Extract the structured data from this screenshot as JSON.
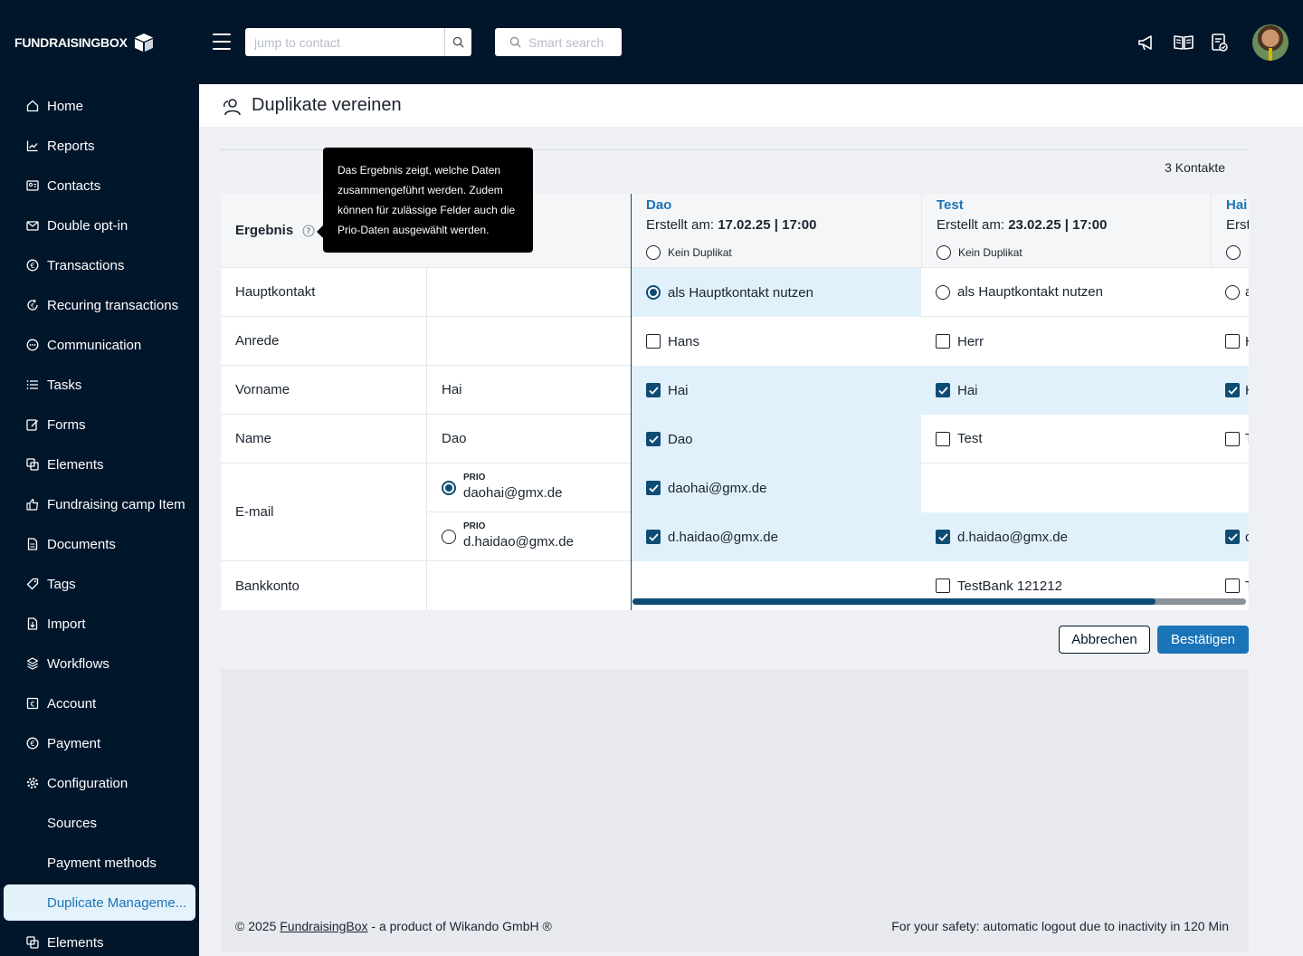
{
  "brand": {
    "name": "FUNDRAISINGBOX"
  },
  "topbar": {
    "jump_placeholder": "jump to contact",
    "smart_search_placeholder": "Smart search",
    "icons": [
      "megaphone-icon",
      "book-icon",
      "checklist-icon"
    ]
  },
  "sidebar": {
    "items": [
      {
        "label": "Home",
        "icon": "home-icon"
      },
      {
        "label": "Reports",
        "icon": "chart-icon"
      },
      {
        "label": "Contacts",
        "icon": "contacts-icon"
      },
      {
        "label": "Double opt-in",
        "icon": "mail-icon"
      },
      {
        "label": "Transactions",
        "icon": "euro-icon"
      },
      {
        "label": "Recuring transactions",
        "icon": "recurring-icon"
      },
      {
        "label": "Communication",
        "icon": "chat-icon"
      },
      {
        "label": "Tasks",
        "icon": "list-icon"
      },
      {
        "label": "Forms",
        "icon": "form-icon"
      },
      {
        "label": "Elements",
        "icon": "elements-icon"
      },
      {
        "label": "Fundraising camp Item",
        "icon": "thumbs-up-icon"
      },
      {
        "label": "Documents",
        "icon": "document-icon"
      },
      {
        "label": "Tags",
        "icon": "tag-icon"
      },
      {
        "label": "Import",
        "icon": "import-icon"
      },
      {
        "label": "Workflows",
        "icon": "workflow-icon"
      },
      {
        "label": "Account",
        "icon": "account-icon"
      },
      {
        "label": "Payment",
        "icon": "euro-icon"
      },
      {
        "label": "Configuration",
        "icon": "gear-icon"
      },
      {
        "label": "Sources",
        "icon": ""
      },
      {
        "label": "Payment methods",
        "icon": ""
      },
      {
        "label": "Duplicate Manageme...",
        "icon": "",
        "active": true
      },
      {
        "label": "Elements",
        "icon": "elements-icon"
      }
    ]
  },
  "page": {
    "title": "Duplikate vereinen",
    "contact_count": "3 Kontakte"
  },
  "table": {
    "result_header": "Ergebnis",
    "tooltip": "Das Ergebnis zeigt, welche Daten zusammengeführt werden. Zudem können für zulässige Felder auch die Prio-Daten ausgewählt werden.",
    "rows": {
      "hauptkontakt": "Hauptkontakt",
      "anrede": "Anrede",
      "vorname": "Vorname",
      "name": "Name",
      "email": "E-mail",
      "bankkonto": "Bankkonto"
    },
    "result": {
      "vorname": "Hai",
      "name": "Dao",
      "email_options": [
        {
          "prio_label": "PRIO",
          "value": "daohai@gmx.de",
          "selected": true
        },
        {
          "prio_label": "PRIO",
          "value": "d.haidao@gmx.de",
          "selected": false
        }
      ]
    },
    "columns": [
      {
        "name": "Dao",
        "created_label": "Erstellt am:",
        "created": "17.02.25 | 17:00",
        "no_duplicate": "Kein Duplikat",
        "main_contact": "als Hauptkontakt nutzen",
        "main_selected": true,
        "anrede": "Hans",
        "vorname": "Hai",
        "email1": "daohai@gmx.de",
        "email2": "d.haidao@gmx.de",
        "bank": ""
      },
      {
        "name": "Test",
        "created_label": "Erstellt am:",
        "created": "23.02.25 | 17:00",
        "no_duplicate": "Kein Duplikat",
        "main_contact": "als Hauptkontakt nutzen",
        "main_selected": false,
        "anrede": "Herr",
        "vorname": "Hai",
        "email1": "",
        "email2": "d.haidao@gmx.de",
        "bank": "TestBank 121212"
      },
      {
        "name": "Hai",
        "created_label": "Erst"
      }
    ],
    "horizontal_scroll_position": 0.85
  },
  "actions": {
    "cancel": "Abbrechen",
    "confirm": "Bestätigen"
  },
  "footer": {
    "copyright_prefix": "© 2025",
    "brand_link": "FundraisingBox",
    "copyright_suffix": "- a product of Wikando GmbH ®",
    "logout_notice": "For your safety: automatic logout due to inactivity in 120 Min"
  },
  "colors": {
    "navy": "#02162b",
    "accent": "#1a74b8",
    "check": "#0f4c74",
    "selected_bg": "#e0f1fc"
  }
}
